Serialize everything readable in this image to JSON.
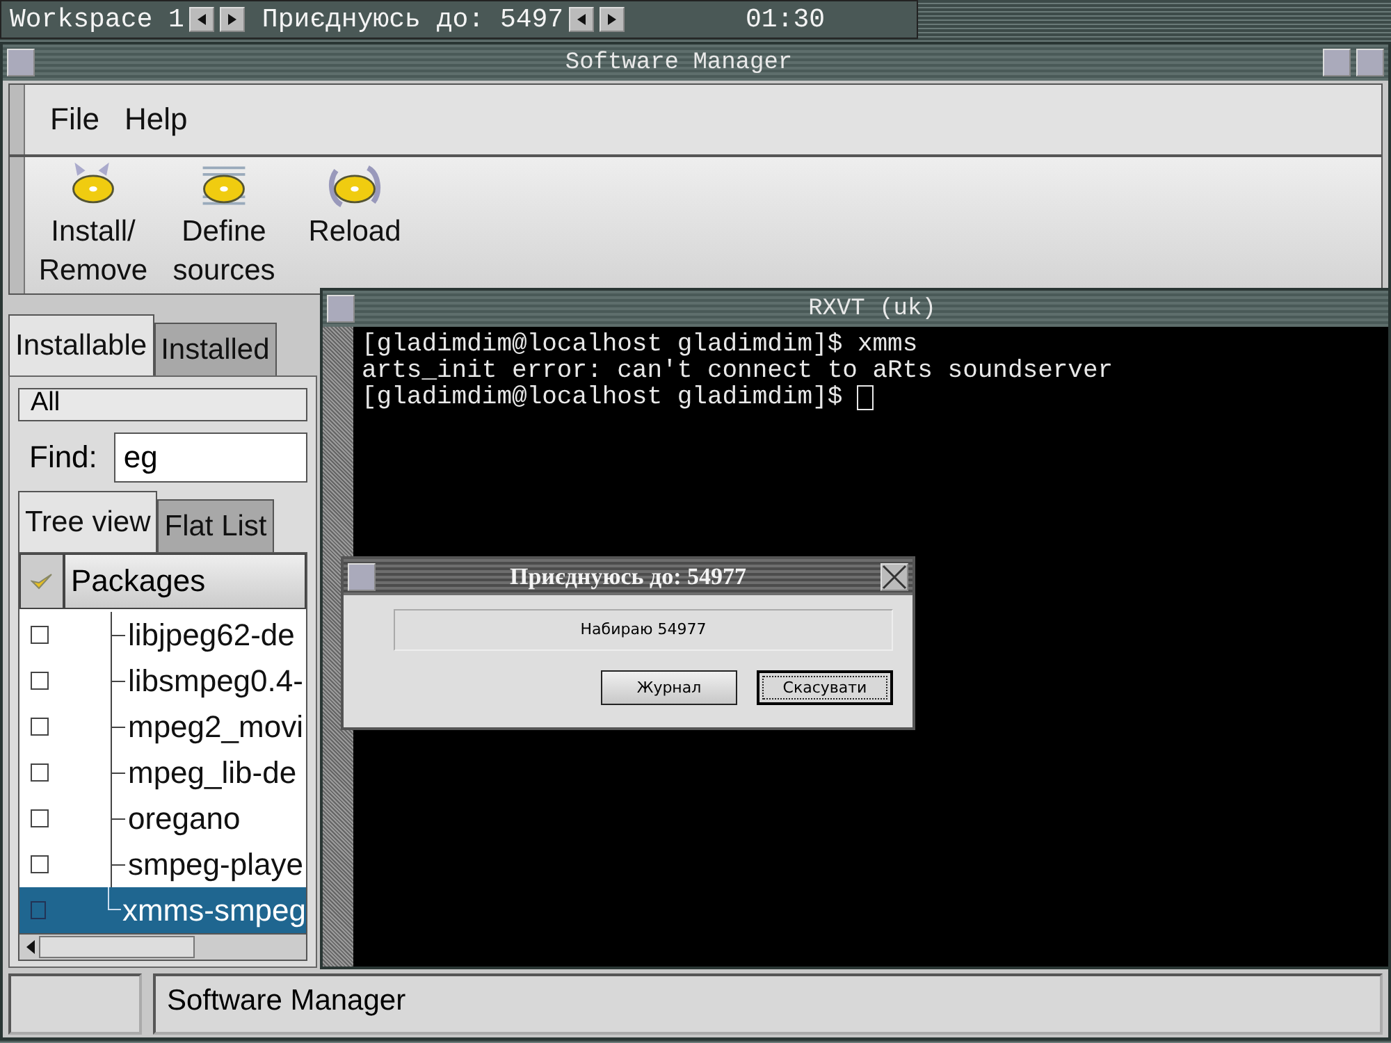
{
  "panel": {
    "workspace": "Workspace 1",
    "task": "Приєднуюсь до: 5497",
    "clock": "01:30"
  },
  "software_manager": {
    "title": "Software Manager",
    "menu": [
      "File",
      "Help"
    ],
    "toolbar": [
      {
        "kind": "install",
        "label": "Install/ Remove"
      },
      {
        "kind": "sources",
        "label": "Define sources"
      },
      {
        "kind": "reload",
        "label": "Reload"
      }
    ],
    "tabs": [
      {
        "label": "Installable",
        "selected": true
      },
      {
        "label": "Installed",
        "selected": false
      }
    ],
    "filter": "All",
    "find": {
      "label": "Find:",
      "value": "eg"
    },
    "view_tabs": [
      {
        "label": "Tree view",
        "selected": true
      },
      {
        "label": "Flat List",
        "selected": false
      }
    ],
    "column": {
      "label": "Packages",
      "checked": true
    },
    "packages": [
      {
        "name": "libjpeg62-de",
        "checked": false,
        "selected": false
      },
      {
        "name": "libsmpeg0.4-",
        "checked": false,
        "selected": false
      },
      {
        "name": "mpeg2_movi",
        "checked": false,
        "selected": false
      },
      {
        "name": "mpeg_lib-de",
        "checked": false,
        "selected": false
      },
      {
        "name": "oregano",
        "checked": false,
        "selected": false
      },
      {
        "name": "smpeg-playe",
        "checked": false,
        "selected": false
      },
      {
        "name": "xmms-smpeg",
        "checked": false,
        "selected": true
      }
    ],
    "status": "Software Manager"
  },
  "terminal": {
    "title": "RXVT (uk)",
    "lines": [
      "[gladimdim@localhost gladimdim]$ xmms",
      "arts_init error: can't connect to aRts soundserver",
      "[gladimdim@localhost gladimdim]$"
    ]
  },
  "dialog": {
    "title": "Приєднуюсь до: 54977",
    "message": "Набираю 54977",
    "buttons": [
      {
        "label": "Журнал",
        "focused": false
      },
      {
        "label": "Скасувати",
        "focused": true
      }
    ]
  }
}
